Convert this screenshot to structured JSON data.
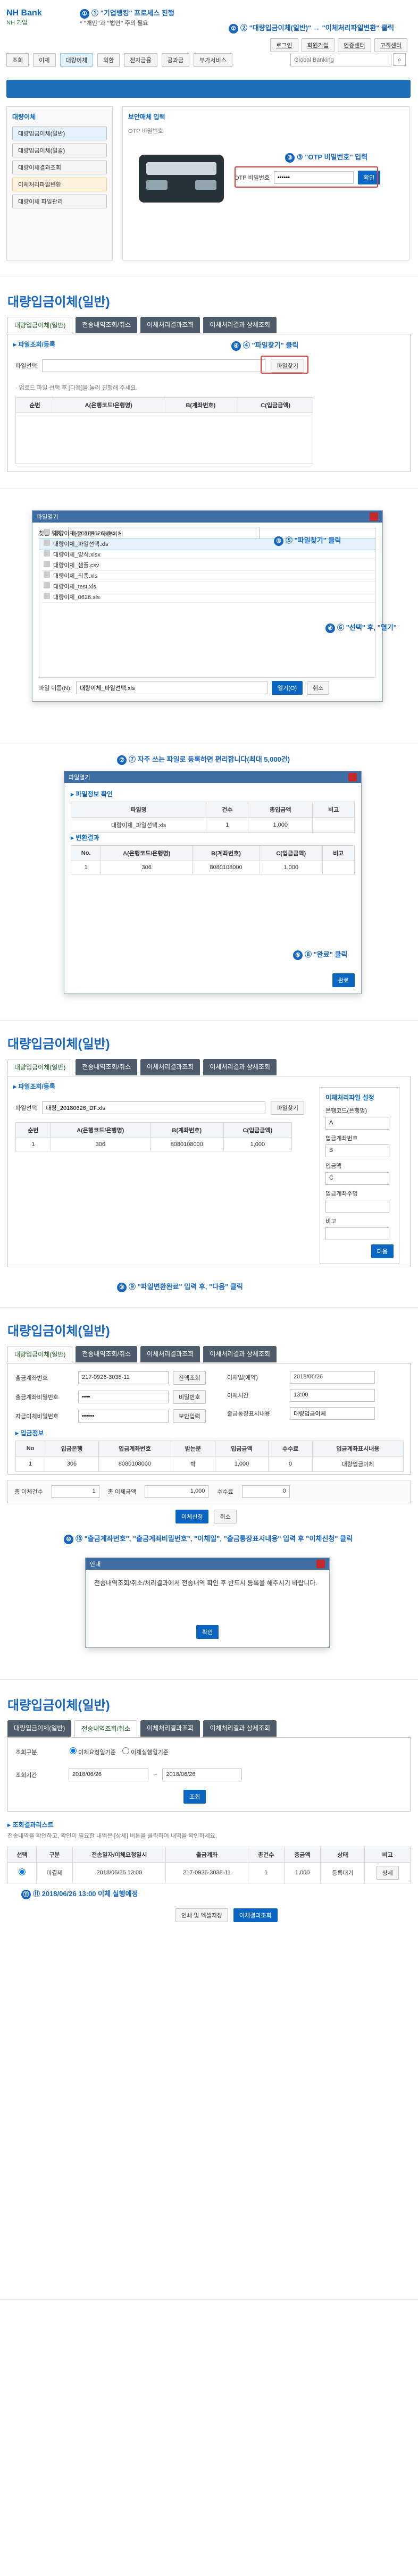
{
  "top_callouts": {
    "c1": "① \"기업뱅킹\" 프로세스 진행",
    "c1_sub": "* \"개인\"과 \"법인\" 주의 필요",
    "c2": "② \"대량입금이체(일반)\" → \"이체처리파일변환\" 클릭",
    "c3": "③ \"OTP 비밀번호\" 입력"
  },
  "header": {
    "logo_text": "NH Bank",
    "brand": "NH 기업",
    "menu_items": [
      "조회",
      "이체",
      "대량이체",
      "외환",
      "전자금융",
      "공과금",
      "부가서비스"
    ],
    "search_placeholder": "Global Banking",
    "top_links": [
      "로그인",
      "회원가입",
      "인증센터",
      "고객센터"
    ]
  },
  "sidebar": {
    "title": "대량이체",
    "items": [
      "대량입금이체(일반)",
      "대량입금이체(일괄)",
      "대량이체결과조회",
      "이체처리파일변환",
      "대량이체 파일관리"
    ]
  },
  "otp_section": {
    "title": "보안매체 입력",
    "otp_label": "OTP 비밀번호",
    "otp_value": "••••••",
    "confirm": "확인"
  },
  "section1": {
    "page_title": "대량입금이체(일반)",
    "tabs": [
      "대량입금이체(일반)",
      "전송내역조회/취소",
      "이체처리결과조회",
      "이체처리결과 상세조회"
    ],
    "file_area_title": "▸ 파일조회/등록",
    "file_label": "파일선택",
    "file_placeholder": "",
    "file_button": "파일찾기",
    "helper": "· 업로드 파일 선택 후 [다음]을 눌러 진행해 주세요.",
    "table_headers": [
      "순번",
      "A(은행코드/은행명)",
      "B(계좌번호)",
      "C(입금금액)"
    ],
    "rows": [],
    "callout_find": "④ \"파일찾기\" 클릭"
  },
  "section2": {
    "callout_dialog": "⑤ \"파일찾기\" 클릭",
    "callout_open": "⑥ \"선택\" 후, \"열기\"",
    "dialog_title": "파일열기",
    "dialog_path_label": "찾는 위치:",
    "dialog_path": "바탕 화면 > 대량이체",
    "list": [
      "대량이체_20180626.xlsx",
      "대량이체_파일선택.xls",
      "대량이체_양식.xlsx",
      "대량이체_샘플.csv",
      "대량이체_최종.xls",
      "대량이체_test.xls",
      "대량이체_0626.xls"
    ],
    "selected_index": 1,
    "filename_label": "파일 이름(N):",
    "filename_value": "대량이체_파일선택.xls",
    "open_button": "열기(O)",
    "cancel_button": "취소"
  },
  "section3": {
    "callout_note": "⑦ 자주 쓰는 파일로 등록하면 편리합니다(최대 5,000건)",
    "window_title": "파일열기",
    "info_title": "▸ 파일정보 확인",
    "info_headers": [
      "파일명",
      "건수",
      "총입금액",
      "비고"
    ],
    "info_rows": [
      [
        "대량이체_파일선택.xls",
        "1",
        "1,000",
        ""
      ]
    ],
    "result_title": "▸ 변환결과",
    "result_headers": [
      "No.",
      "A(은행코드/은행명)",
      "B(계좌번호)",
      "C(입금금액)",
      "비고"
    ],
    "result_rows": [
      [
        "1",
        "306",
        "8080108000",
        "1,000",
        ""
      ]
    ],
    "confirm_callout": "⑧ \"완료\" 클릭",
    "confirm_button": "완료"
  },
  "section4": {
    "page_title": "대량입금이체(일반)",
    "tabs": [
      "대량입금이체(일반)",
      "전송내역조회/취소",
      "이체처리결과조회",
      "이체처리결과 상세조회"
    ],
    "file_area_title": "▸ 파일조회/등록",
    "file_label": "파일선택",
    "file_value": "대량_20180626_DF.xls",
    "file_button": "파일찾기",
    "table_headers": [
      "순번",
      "A(은행코드/은행명)",
      "B(계좌번호)",
      "C(입금금액)"
    ],
    "rows": [
      [
        "1",
        "306",
        "8080108000",
        "1,000"
      ]
    ],
    "right_panel_title": "이체처리파일 설정",
    "right_fields": [
      {
        "label": "은행코드(은행명)",
        "value": "A"
      },
      {
        "label": "입금계좌번호",
        "value": "B"
      },
      {
        "label": "입금액",
        "value": "C"
      },
      {
        "label": "입금계좌주명",
        "value": ""
      },
      {
        "label": "비고",
        "value": ""
      }
    ],
    "callout_next": "⑨ \"파일변환완료\" 입력 후, \"다음\" 클릭",
    "next_button": "다음"
  },
  "section5": {
    "page_title": "대량입금이체(일반)",
    "tabs": [
      "대량입금이체(일반)",
      "전송내역조회/취소",
      "이체처리결과조회",
      "이체처리결과 상세조회"
    ],
    "fields": [
      {
        "label": "출금계좌번호",
        "value": "217-0926-3038-11",
        "pill": "잔액조회"
      },
      {
        "label": "출금계좌비밀번호",
        "value": "••••",
        "pill": "비밀번호"
      },
      {
        "label": "자금이체비밀번호",
        "value": "••••••",
        "pill": "보안입력"
      }
    ],
    "right_fields": [
      {
        "label": "이체일(예약)",
        "value": "2018/06/26"
      },
      {
        "label": "이체시간",
        "value": "13:00"
      },
      {
        "label": "출금통장표시내용",
        "value": "대량입금이체"
      }
    ],
    "deposit_title": "▸ 입금정보",
    "deposit_headers": [
      "No",
      "입금은행",
      "입금계좌번호",
      "받는분",
      "입금금액",
      "수수료",
      "입금계좌표시내용"
    ],
    "deposit_rows": [
      [
        "1",
        "306",
        "8080108000",
        "박",
        "1,000",
        "0",
        "대량입금이체"
      ]
    ],
    "totals": {
      "count_label": "총 이체건수",
      "count": "1",
      "amount_label": "총 이체금액",
      "amount": "1,000",
      "fee_label": "수수료",
      "fee": "0"
    },
    "buttons": [
      "이체신청",
      "취소"
    ],
    "callout_confirm": "⑩ \"출금계좌번호\", \"출금계좌비밀번호\", \"이체일\", \"출금통장표시내용\" 입력 후 \"이체신청\" 클릭",
    "modal_title": "안내",
    "modal_text": "전송내역조회/취소/처리결과에서 전송내역 확인 후 반드시 등록을 해주시기 바랍니다.",
    "modal_button": "확인"
  },
  "section6": {
    "page_title": "대량입금이체(일반)",
    "tabs": [
      "대량입금이체(일반)",
      "전송내역조회/취소",
      "이체처리결과조회",
      "이체처리결과 상세조회"
    ],
    "search_area": [
      {
        "label": "조회구분",
        "options": [
          "이체요청일기준",
          "이체실행일기준"
        ],
        "selected": 0
      },
      {
        "label": "조회기간",
        "from": "2018/06/26",
        "to": "2018/06/26"
      }
    ],
    "search_button": "조회",
    "result_title": "▸ 조회결과리스트",
    "result_desc": "전송내역을 확인하고, 확인이 필요한 내역은 [상세] 버튼을 클릭하여 내역을 확인하세요.",
    "table_headers": [
      "선택",
      "구분",
      "전송일자/이체요청일시",
      "출금계좌",
      "총건수",
      "총금액",
      "상태",
      "비고"
    ],
    "table_rows": [
      [
        "",
        "미결제",
        "2018/06/26 13:00",
        "217-0926-3038-11",
        "1",
        "1,000",
        "등록대기",
        "상세"
      ]
    ],
    "callout_final": "⑪ 2018/06/26 13:00 이체 실행예정",
    "bottom_buttons": [
      "인쇄 및 엑셀저장",
      "이체결과조회"
    ]
  },
  "colors": {
    "primary_blue": "#0b66c3",
    "callout_blue": "#1565c0",
    "tab_gray": "#4d5b6a",
    "highlight_red": "#e53935",
    "success_green": "#2e7d32"
  },
  "icons": {
    "folder_icon": "folder-icon",
    "file_icon": "file-icon",
    "search_icon": "search-icon",
    "close_icon": "close-icon"
  }
}
